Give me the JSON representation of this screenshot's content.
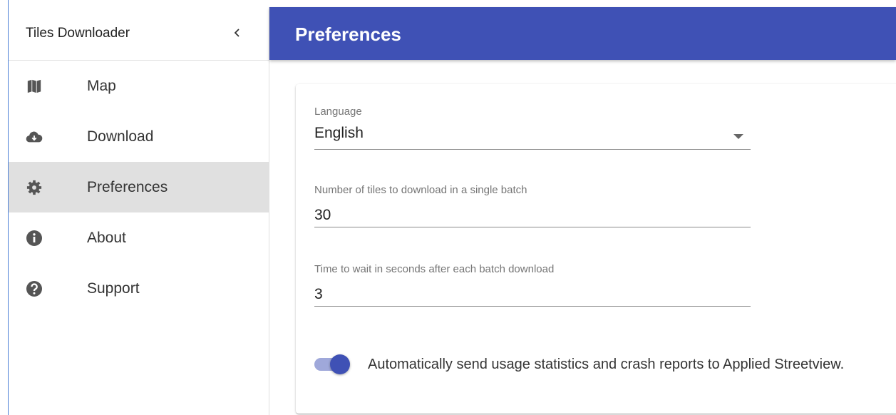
{
  "drawer": {
    "title": "Tiles Downloader",
    "items": [
      {
        "label": "Map",
        "icon": "map-icon"
      },
      {
        "label": "Download",
        "icon": "cloud-download-icon"
      },
      {
        "label": "Preferences",
        "icon": "gear-icon",
        "active": true
      },
      {
        "label": "About",
        "icon": "info-icon"
      },
      {
        "label": "Support",
        "icon": "help-icon"
      }
    ]
  },
  "appbar": {
    "title": "Preferences"
  },
  "preferences": {
    "language": {
      "label": "Language",
      "value": "English"
    },
    "batch_size": {
      "label": "Number of tiles to download in a single batch",
      "value": "30"
    },
    "wait_time": {
      "label": "Time to wait in seconds after each batch download",
      "value": "3"
    },
    "usage_stats": {
      "label": "Automatically send usage statistics and crash reports to Applied Streetview.",
      "enabled": true
    }
  },
  "colors": {
    "primary": "#3f51b5",
    "switch_track": "#9fa8da",
    "active_nav_bg": "#e0e0e0",
    "icon": "#555555"
  }
}
